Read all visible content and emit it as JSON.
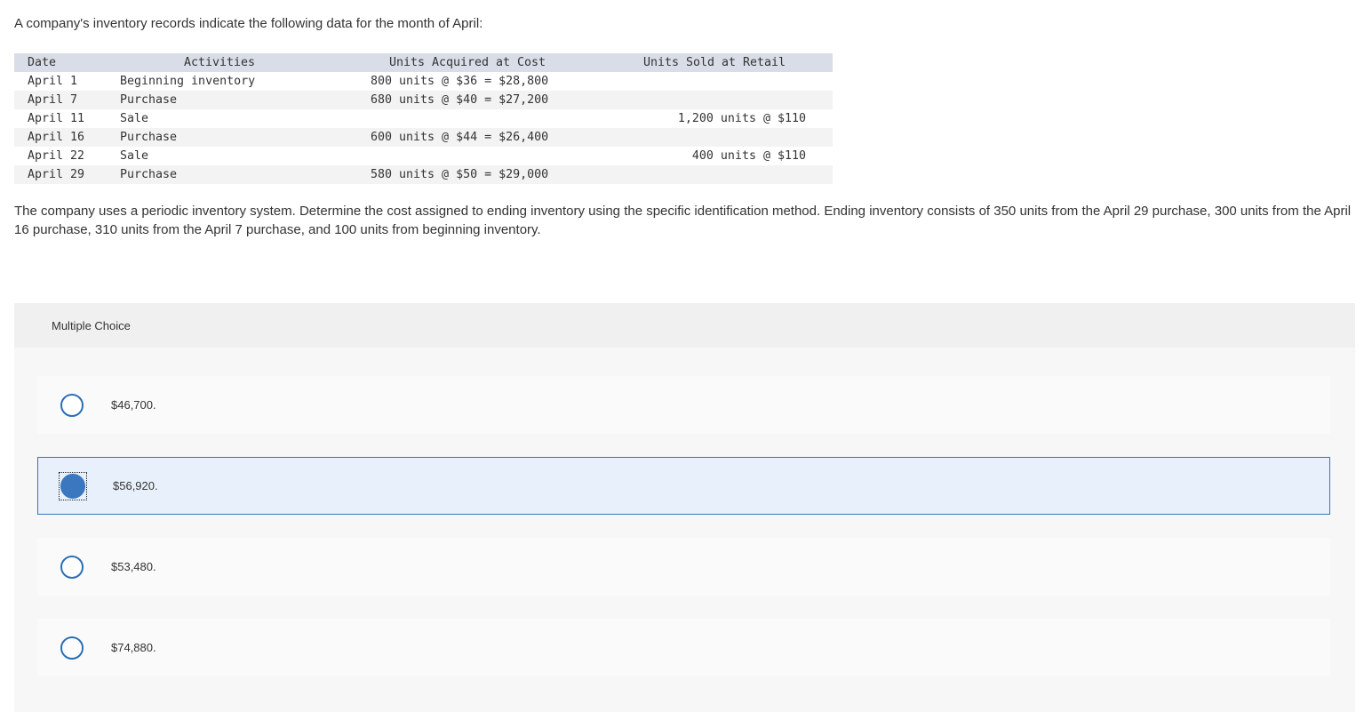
{
  "intro": "A company's inventory records indicate the following data for the month of April:",
  "table": {
    "headers": {
      "date": "Date",
      "activities": "Activities",
      "acquired": "Units Acquired at Cost",
      "sold": "Units Sold at Retail"
    },
    "rows": [
      {
        "date": "April 1",
        "activity": "Beginning inventory",
        "acquired": "800 units @ $36 = $28,800",
        "sold": ""
      },
      {
        "date": "April 7",
        "activity": "Purchase",
        "acquired": "680 units @ $40 = $27,200",
        "sold": ""
      },
      {
        "date": "April 11",
        "activity": "Sale",
        "acquired": "",
        "sold": "1,200 units @ $110"
      },
      {
        "date": "April 16",
        "activity": "Purchase",
        "acquired": "600 units @ $44 = $26,400",
        "sold": ""
      },
      {
        "date": "April 22",
        "activity": "Sale",
        "acquired": "",
        "sold": "400 units @ $110"
      },
      {
        "date": "April 29",
        "activity": "Purchase",
        "acquired": "580 units @ $50 = $29,000",
        "sold": ""
      }
    ]
  },
  "question": "The company uses a periodic inventory system. Determine the cost assigned to ending inventory using the specific identification method. Ending inventory consists of 350 units from the April 29 purchase, 300 units from the April 16 purchase, 310 units from the April 7 purchase, and 100 units from beginning inventory.",
  "multiple_choice": {
    "title": "Multiple Choice",
    "selected_index": 1,
    "options": [
      {
        "label": "$46,700."
      },
      {
        "label": "$56,920."
      },
      {
        "label": "$53,480."
      },
      {
        "label": "$74,880."
      }
    ]
  },
  "colors": {
    "accent": "#2b6fb5",
    "selected_fill": "#3a77bf",
    "selected_bg": "#e8f1fb",
    "table_header_bg": "#d9dde7"
  }
}
